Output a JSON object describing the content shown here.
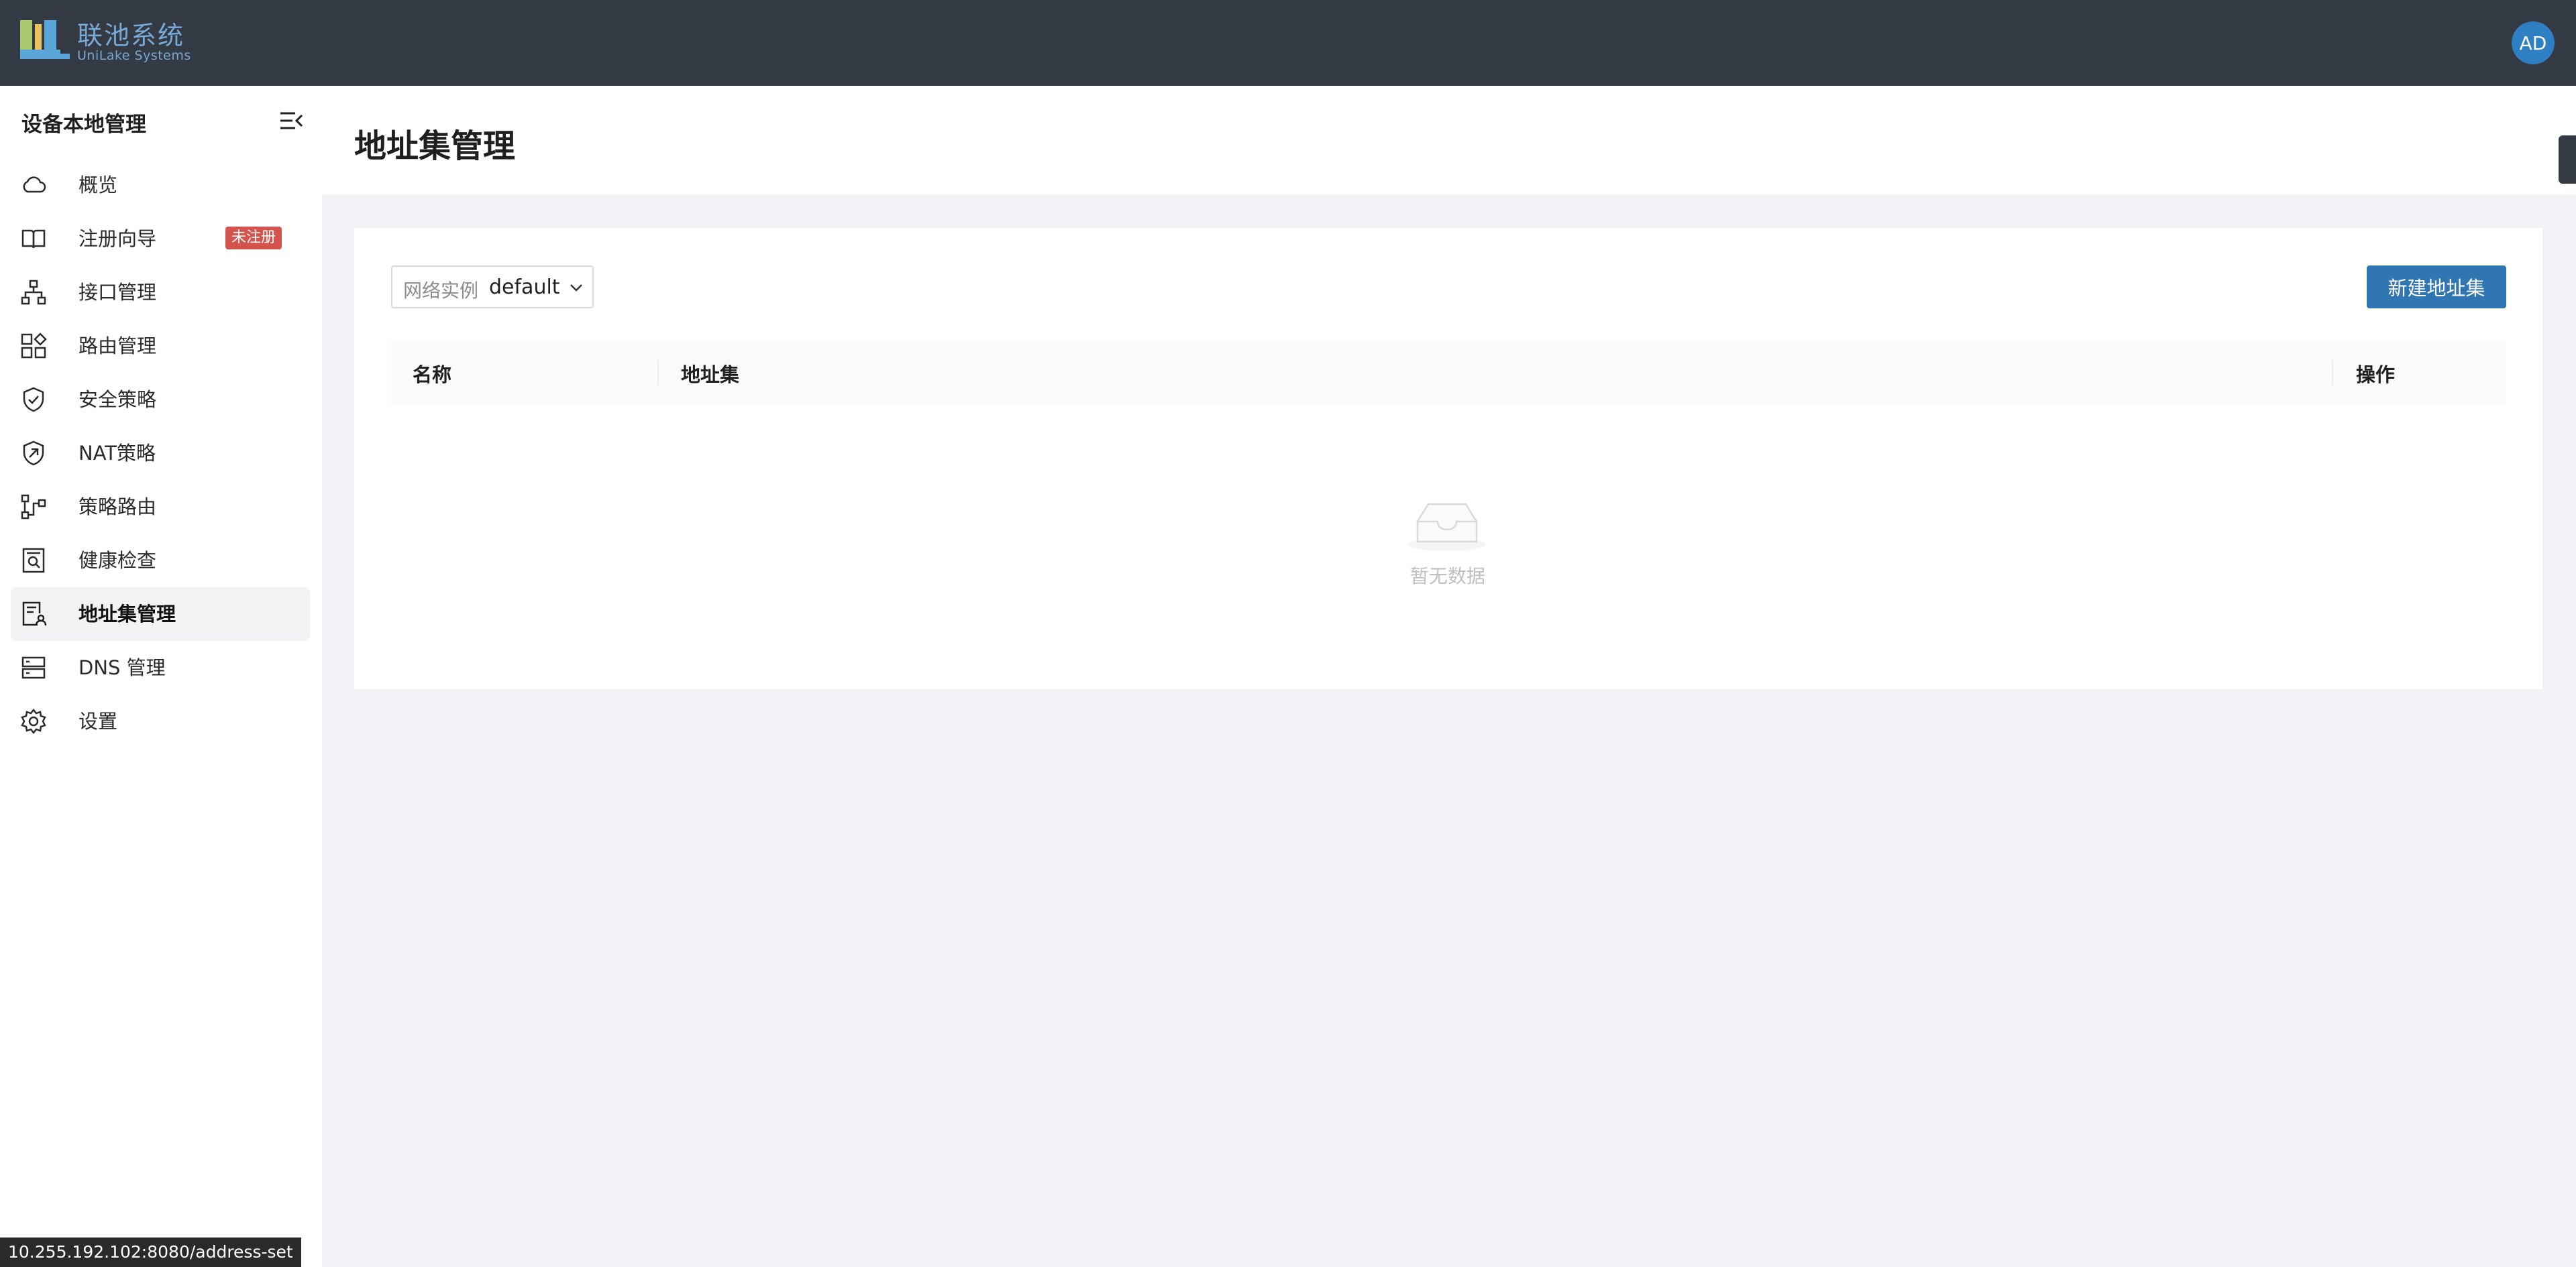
{
  "header": {
    "brand_name": "联池系统",
    "brand_sub": "UniLake Systems",
    "avatar_text": "AD",
    "colors": {
      "bar": "#343a43",
      "brand": "#76a9d6",
      "avatar": "#2f80c3"
    }
  },
  "sidebar": {
    "title": "设备本地管理",
    "collapse_icon": "menu-fold-icon",
    "items": [
      {
        "label": "概览",
        "icon": "cloud-icon"
      },
      {
        "label": "注册向导",
        "icon": "book-icon",
        "badge": "未注册"
      },
      {
        "label": "接口管理",
        "icon": "network-icon"
      },
      {
        "label": "路由管理",
        "icon": "apps-icon"
      },
      {
        "label": "安全策略",
        "icon": "shield-check-icon"
      },
      {
        "label": "NAT策略",
        "icon": "shield-link-icon"
      },
      {
        "label": "策略路由",
        "icon": "policy-route-icon"
      },
      {
        "label": "健康检查",
        "icon": "health-check-icon"
      },
      {
        "label": "地址集管理",
        "icon": "address-list-icon",
        "active": true
      },
      {
        "label": "DNS 管理",
        "icon": "server-icon"
      },
      {
        "label": "设置",
        "icon": "gear-icon"
      }
    ]
  },
  "main": {
    "title": "地址集管理",
    "filter": {
      "label": "网络实例",
      "value": "default"
    },
    "new_button": "新建地址集",
    "table": {
      "columns": [
        "名称",
        "地址集",
        "操作"
      ],
      "rows": [],
      "empty_text": "暂无数据"
    },
    "accent": "#2f76b2"
  },
  "status_url": "10.255.192.102:8080/address-set"
}
